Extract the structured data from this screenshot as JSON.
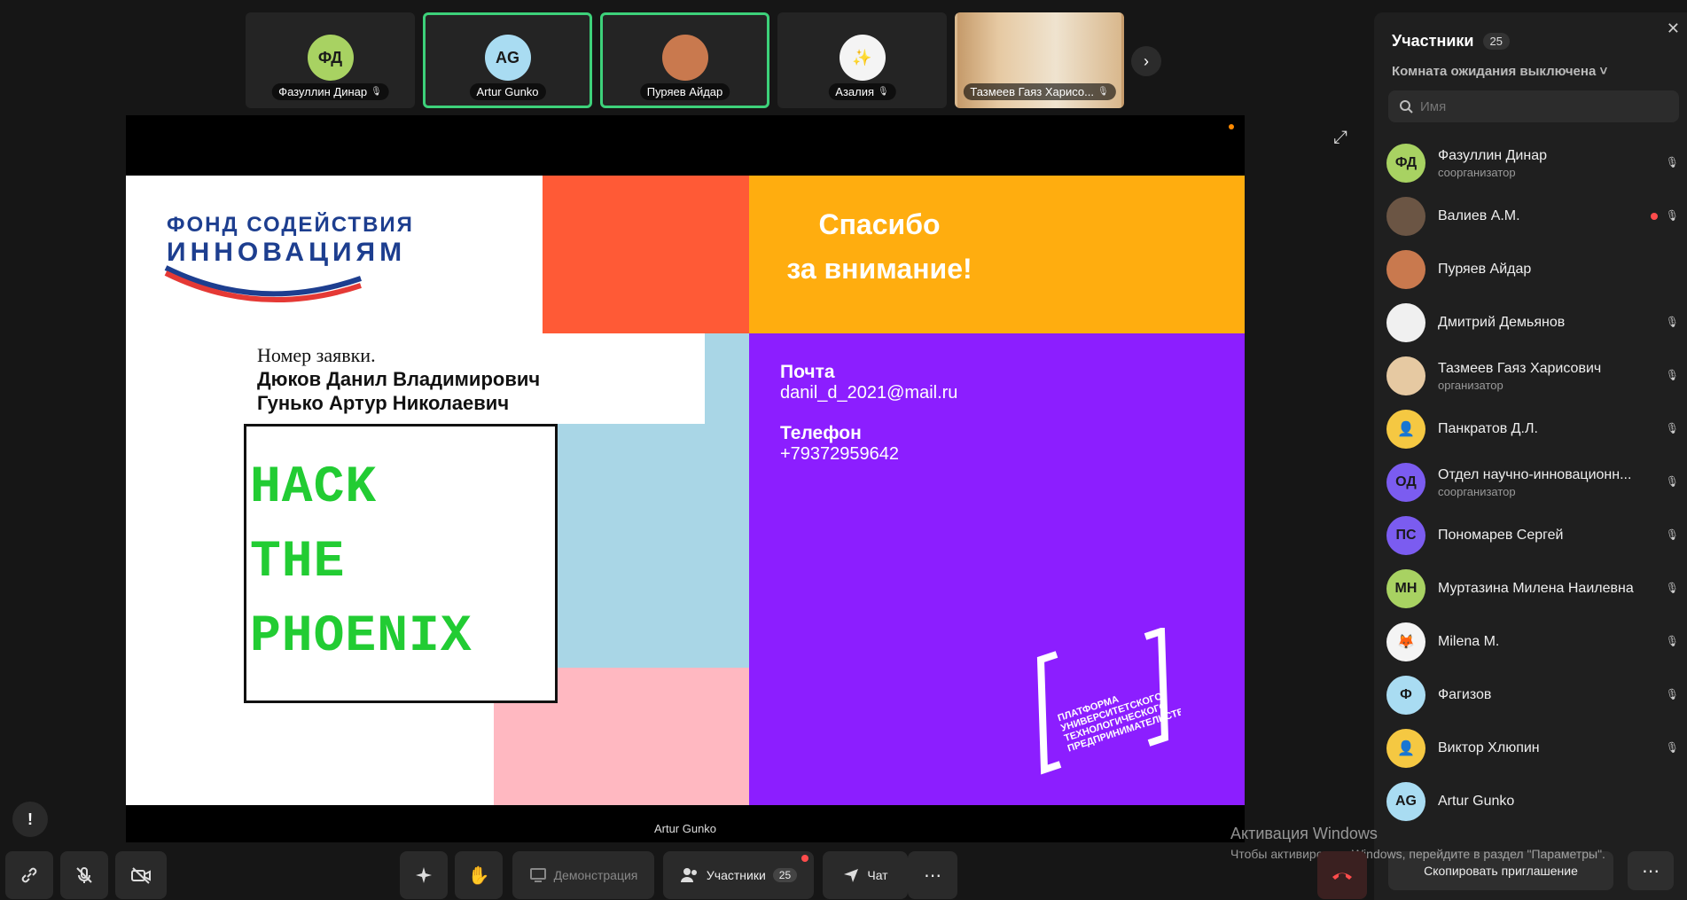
{
  "thumbnails": [
    {
      "initials": "ФД",
      "name": "Фазуллин Динар",
      "color": "#a8d262",
      "speaking": false,
      "muted": true
    },
    {
      "initials": "AG",
      "name": "Artur Gunko",
      "color": "#a9dcf2",
      "speaking": true,
      "muted": false
    },
    {
      "initials": "",
      "name": "Пуряев Айдар",
      "color": "#c9794e",
      "speaking": true,
      "muted": false
    },
    {
      "initials": "✨",
      "name": "Азалия",
      "color": "#f4f4f4",
      "speaking": false,
      "muted": true
    },
    {
      "initials": "",
      "name": "Тазмеев Гаяз Харисо...",
      "color": "#e6c9a2",
      "speaking": false,
      "muted": true
    }
  ],
  "stage": {
    "presenter_name": "Artur Gunko"
  },
  "slide": {
    "fond_line1": "ФОНД СОДЕЙСТВИЯ",
    "fond_line2": "ИННОВАЦИЯМ",
    "application_label": "Номер заявки.",
    "author1": "Дюков Данил Владимирович",
    "author2": "Гунько Артур Николаевич",
    "hack_line1": "HACK",
    "hack_line2": "THE",
    "hack_line3": "PHOENIX",
    "thanks_line1": "Спасибо",
    "thanks_line2": "за внимание!",
    "mail_label": "Почта",
    "mail_value": "danil_d_2021@mail.ru",
    "phone_label": "Телефон",
    "phone_value": "+79372959642",
    "platform_text": "ПЛАТФОРМА УНИВЕРСИТЕТСКОГО ТЕХНОЛОГИЧЕСКОГО ПРЕДПРИНИМАТЕЛЬСТВА",
    "colors": {
      "orange_red": "#ff5a36",
      "amber": "#ffad0f",
      "purple": "#8c1eff",
      "light_blue": "#a9d6e6",
      "pink": "#ffb8c1"
    }
  },
  "panel": {
    "title": "Участники",
    "count": "25",
    "waiting_room": "Комната ожидания выключена ˅",
    "search_placeholder": "Имя",
    "participants": [
      {
        "initials": "ФД",
        "name": "Фазуллин Динар",
        "role": "соорганизатор",
        "color": "#a8d262",
        "muted": true,
        "dot": false
      },
      {
        "initials": "",
        "name": "Валиев А.М.",
        "role": "",
        "color": "#6b5544",
        "muted": true,
        "dot": true
      },
      {
        "initials": "",
        "name": "Пуряев Айдар",
        "role": "",
        "color": "#c9794e",
        "muted": false,
        "dot": false
      },
      {
        "initials": "",
        "name": "Дмитрий Демьянов",
        "role": "",
        "color": "#f0f0f0",
        "muted": true,
        "dot": false
      },
      {
        "initials": "",
        "name": "Тазмеев Гаяз Харисович",
        "role": "организатор",
        "color": "#e6c9a2",
        "muted": true,
        "dot": false
      },
      {
        "initials": "👤",
        "name": "Панкратов Д.Л.",
        "role": "",
        "color": "#f5c842",
        "muted": true,
        "dot": false
      },
      {
        "initials": "ОД",
        "name": "Отдел научно-инновационн...",
        "role": "соорганизатор",
        "color": "#7b5cf0",
        "muted": true,
        "dot": false
      },
      {
        "initials": "ПС",
        "name": "Пономарев Сергей",
        "role": "",
        "color": "#7b5cf0",
        "muted": true,
        "dot": false
      },
      {
        "initials": "МН",
        "name": "Муртазина Милена Наилевна",
        "role": "",
        "color": "#a8d262",
        "muted": true,
        "dot": false
      },
      {
        "initials": "🦊",
        "name": "Milena M.",
        "role": "",
        "color": "#f4f4f4",
        "muted": true,
        "dot": false
      },
      {
        "initials": "Ф",
        "name": "Фагизов",
        "role": "",
        "color": "#a9dcf2",
        "muted": true,
        "dot": false
      },
      {
        "initials": "👤",
        "name": "Виктор Хлюпин",
        "role": "",
        "color": "#f5c842",
        "muted": true,
        "dot": false
      },
      {
        "initials": "AG",
        "name": "Artur Gunko",
        "role": "",
        "color": "#a9dcf2",
        "muted": false,
        "dot": false
      }
    ],
    "invite_label": "Скопировать приглашение",
    "more_label": "⋯"
  },
  "windows_activation": {
    "title": "Активация Windows",
    "subtitle": "Чтобы активировать Windows, перейдите в раздел \"Параметры\"."
  },
  "toolbar": {
    "demo_label": "Демонстрация",
    "participants_label": "Участники",
    "participants_count": "25",
    "chat_label": "Чат",
    "more_label": "⋯",
    "feedback_label": "!"
  }
}
